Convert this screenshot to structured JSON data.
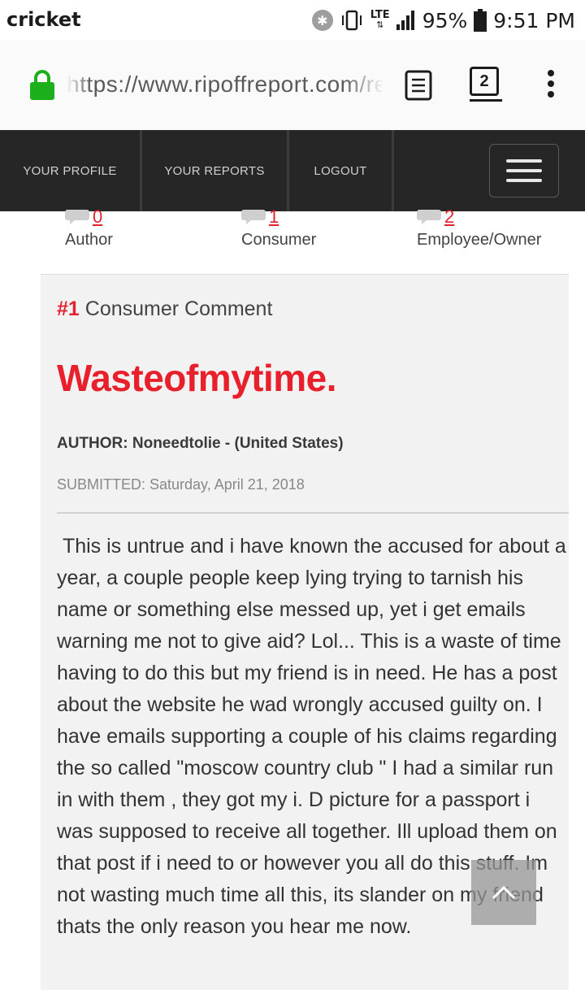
{
  "status_bar": {
    "carrier": "cricket",
    "network": "LTE",
    "battery_percent": "95%",
    "time": "9:51 PM"
  },
  "browser": {
    "url": "https://www.ripoffreport.com/re",
    "tab_count": "2"
  },
  "nav": {
    "items": [
      "YOUR PROFILE",
      "YOUR REPORTS",
      "LOGOUT"
    ]
  },
  "counts": [
    {
      "value": "0",
      "label": "Author"
    },
    {
      "value": "1",
      "label": "Consumer"
    },
    {
      "value": "2",
      "label": "Employee/Owner"
    }
  ],
  "comment": {
    "number": "#1",
    "type": "Consumer Comment",
    "title": "Wasteofmytime.",
    "author": "AUTHOR: Noneedtolie - (United States)",
    "submitted": "SUBMITTED: Saturday, April 21, 2018",
    "body": "This is untrue and i have known the accused for about a year, a couple people keep lying trying to tarnish his name or something else messed up, yet i get emails warning me not to give aid? Lol... This is a waste of time having to do this but my friend is in need. He has a post about the website he wad wrongly accused guilty on. I have emails supporting a couple of his claims regarding the so called \"moscow country club \" I had a similar run in with them , they got my i. D picture for a passport i was supposed to receive all together. Ill upload them on that post if i need to or however you all do this stuff. Im not wasting much time all this, its slander on my friend thats the only reason you hear me now."
  },
  "colors": {
    "accent_red": "#e8202c",
    "nav_bg": "#262626",
    "comment_bg": "#f2f2f2"
  }
}
